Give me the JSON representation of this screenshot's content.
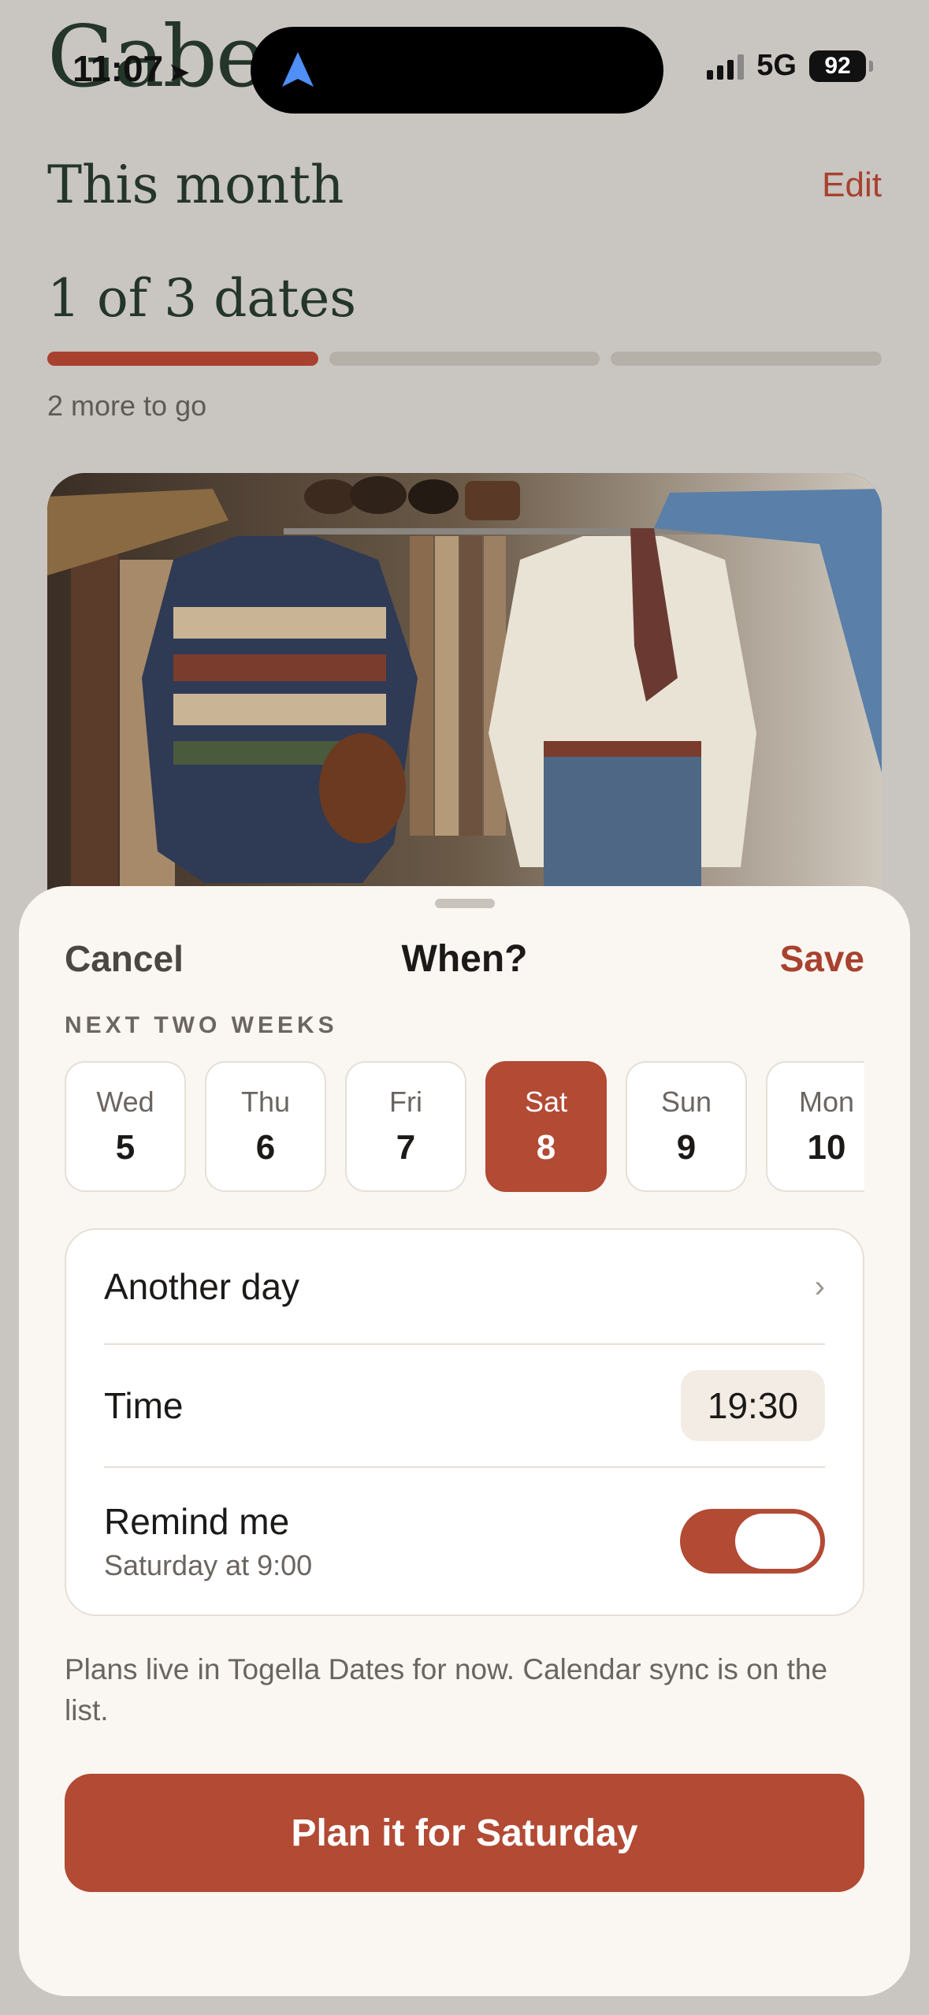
{
  "status_bar": {
    "time": "11:07",
    "network": "5G",
    "battery": "92"
  },
  "background": {
    "partial_title": "Gabe",
    "month_title": "This month",
    "edit_label": "Edit",
    "dates_count": "1 of 3 dates",
    "progress": {
      "completed": 1,
      "total": 3
    },
    "more_to_go": "2 more to go"
  },
  "sheet": {
    "cancel_label": "Cancel",
    "title": "When?",
    "save_label": "Save",
    "section_label": "NEXT TWO WEEKS",
    "days": [
      {
        "name": "Wed",
        "num": "5",
        "selected": false
      },
      {
        "name": "Thu",
        "num": "6",
        "selected": false
      },
      {
        "name": "Fri",
        "num": "7",
        "selected": false
      },
      {
        "name": "Sat",
        "num": "8",
        "selected": true
      },
      {
        "name": "Sun",
        "num": "9",
        "selected": false
      },
      {
        "name": "Mon",
        "num": "10",
        "selected": false
      }
    ],
    "another_day_label": "Another day",
    "time_label": "Time",
    "time_value": "19:30",
    "remind_label": "Remind me",
    "remind_sub": "Saturday at 9:00",
    "remind_enabled": true,
    "note": "Plans live in Togella Dates for now. Calendar sync is on the list.",
    "cta_label": "Plan it for Saturday"
  },
  "colors": {
    "accent": "#b24a34",
    "heading_green": "#24352a",
    "sheet_bg": "#faf6f1",
    "backdrop": "#c9c5c0"
  }
}
